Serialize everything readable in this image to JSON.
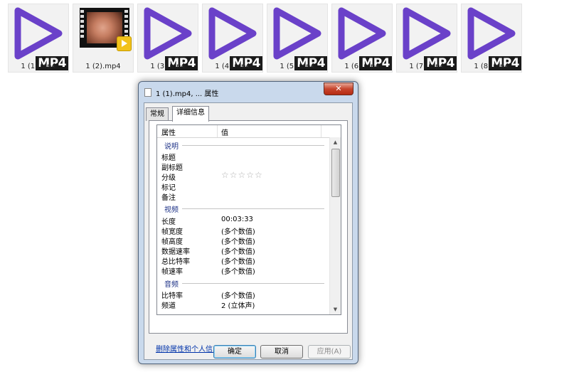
{
  "files": [
    {
      "name": "1 (1).mp4",
      "kind": "mp4"
    },
    {
      "name": "1 (2).mp4",
      "kind": "video-thumbnail"
    },
    {
      "name": "1 (3).mp4",
      "kind": "mp4"
    },
    {
      "name": "1 (4).mp4",
      "kind": "mp4"
    },
    {
      "name": "1 (5).mp4",
      "kind": "mp4"
    },
    {
      "name": "1 (6).mp4",
      "kind": "mp4"
    },
    {
      "name": "1 (7).mp4",
      "kind": "mp4"
    },
    {
      "name": "1 (8).mp4",
      "kind": "mp4"
    }
  ],
  "mp4_tag": "MP4",
  "icon_color": "#6a41c9",
  "dialog": {
    "title": "1 (1).mp4, ... 属性",
    "close_symbol": "✕",
    "tabs": [
      {
        "label": "常规"
      },
      {
        "label": "详细信息"
      }
    ],
    "active_tab": 1,
    "columns": {
      "property": "属性",
      "value": "值"
    },
    "groups": {
      "description": {
        "label": "说明",
        "items": {
          "title": "标题",
          "subtitle": "副标题",
          "rating": "分级",
          "tags": "标记",
          "comments": "备注"
        },
        "rating_stars": "☆☆☆☆☆"
      },
      "video": {
        "label": "视频",
        "rows": [
          {
            "name": "长度",
            "value": "00:03:33"
          },
          {
            "name": "帧宽度",
            "value": "(多个数值)"
          },
          {
            "name": "帧高度",
            "value": "(多个数值)"
          },
          {
            "name": "数据速率",
            "value": "(多个数值)"
          },
          {
            "name": "总比特率",
            "value": "(多个数值)"
          },
          {
            "name": "帧速率",
            "value": "(多个数值)"
          }
        ]
      },
      "audio": {
        "label": "音频",
        "rows": [
          {
            "name": "比特率",
            "value": "(多个数值)"
          },
          {
            "name": "频道",
            "value": "2 (立体声)"
          }
        ]
      }
    },
    "remove_link": "删除属性和个人信息",
    "buttons": {
      "ok": "确定",
      "cancel": "取消",
      "apply": "应用(A)"
    }
  }
}
